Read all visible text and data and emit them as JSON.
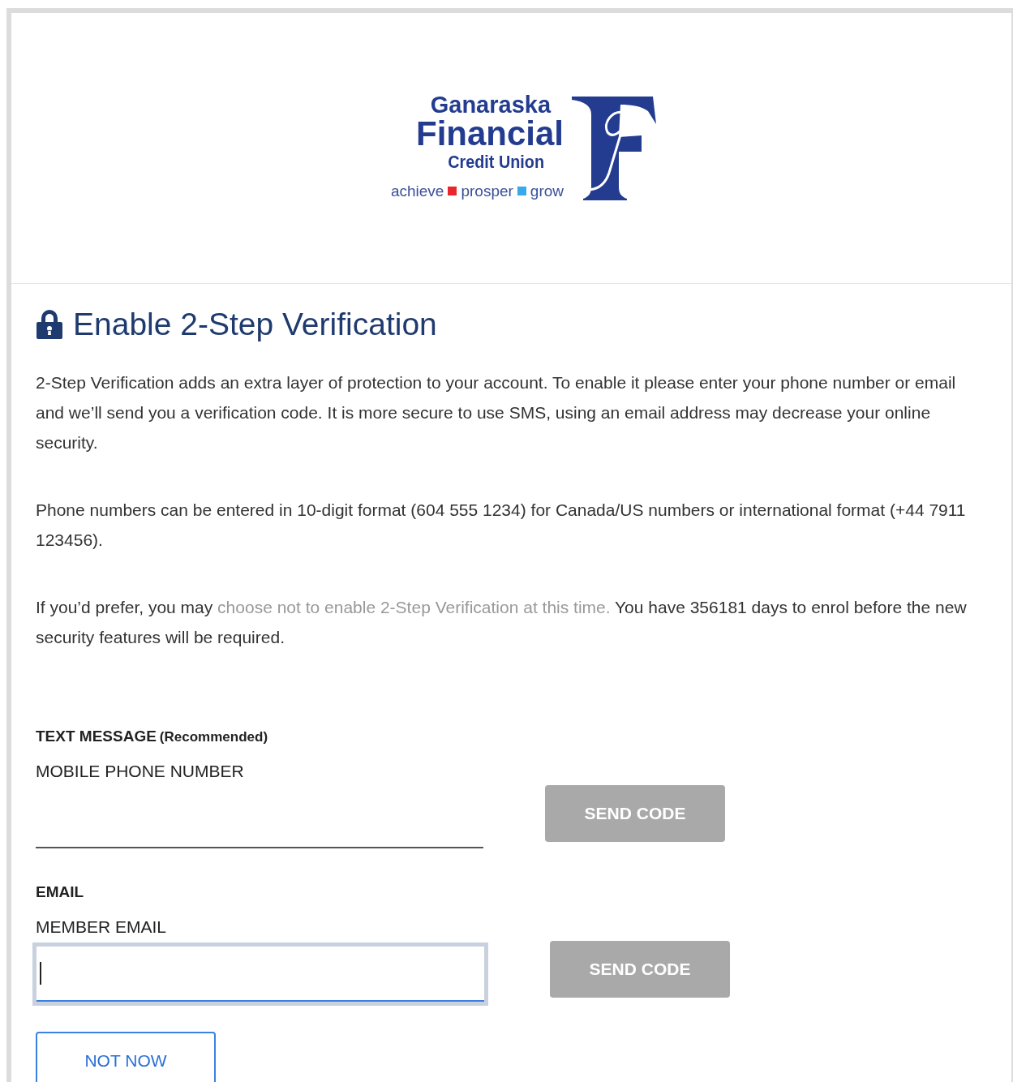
{
  "logo": {
    "line_1": "Ganaraska",
    "line_2": "Financial",
    "line_3": "Credit Union",
    "tagline": [
      {
        "text": "achieve",
        "color": "#e8262b"
      },
      {
        "text": "prosper",
        "color": "#39a9ec"
      },
      {
        "text": "grow"
      }
    ]
  },
  "heading": "Enable 2-Step Verification",
  "paragraphs": [
    {
      "text": "2-Step Verification adds an extra layer of protection to your account. To enable it please enter your phone number or email and we’ll send you a verification code. It is more secure to use SMS, using an email address may decrease your online security."
    },
    {
      "text": "Phone numbers can be entered in 10-digit format (604 555 1234) for Canada/US numbers or international format (+44 7911 123456)."
    },
    {
      "text": "If you’d prefer, you may ",
      "link": "choose not to enable 2-Step Verification at this time.",
      "after": " You have 356181 days to enrol before the new security features will be required."
    }
  ],
  "sections": [
    {
      "title": "TEXT MESSAGE",
      "note": "(Recommended)",
      "field_label": "MOBILE PHONE NUMBER",
      "kind": "underline",
      "focused": false,
      "button": "SEND CODE",
      "button_disabled": true
    },
    {
      "title": "EMAIL",
      "field_label": "MEMBER EMAIL",
      "kind": "boxed",
      "focused": true,
      "button": "SEND CODE",
      "button_disabled": true
    }
  ],
  "secondary_button": "NOT NOW"
}
